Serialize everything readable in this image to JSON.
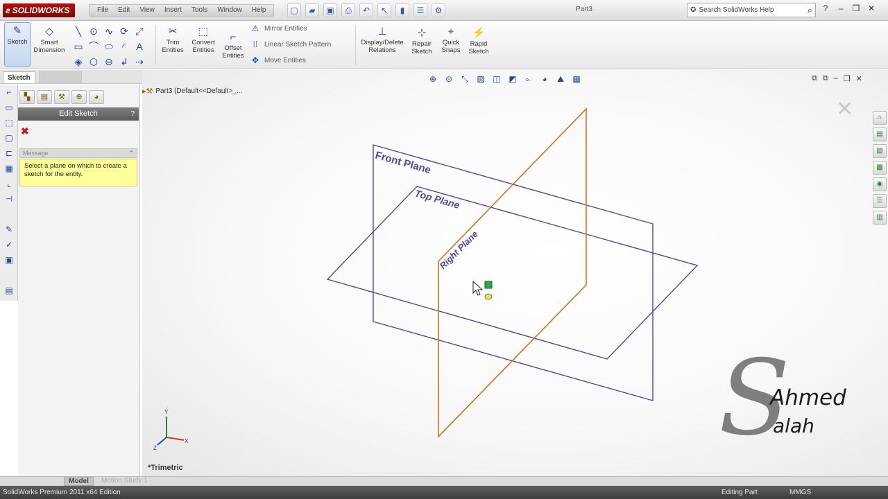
{
  "titlebar": {
    "brand": "SOLIDWORKS",
    "menus": [
      "File",
      "Edit",
      "View",
      "Insert",
      "Tools",
      "Window",
      "Help"
    ],
    "doc_title": "Part3",
    "search_placeholder": "Search SolidWorks Help"
  },
  "command_manager": {
    "sketch": "Sketch",
    "smart_dimension": "Smart\nDimension",
    "trim_entities": "Trim\nEntities",
    "convert_entities": "Convert\nEntities",
    "offset_entities": "Offset\nEntities",
    "mirror_entities": "Mirror Entities",
    "linear_sketch_pattern": "Linear Sketch Pattern",
    "move_entities": "Move Entities",
    "display_delete_relations": "Display/Delete\nRelations",
    "repair_sketch": "Repair\nSketch",
    "quick_snaps": "Quick\nSnaps",
    "rapid_sketch": "Rapid\nSketch"
  },
  "tabs": {
    "sketch": "Sketch"
  },
  "property_manager": {
    "title": "Edit Sketch",
    "help_num": "?",
    "message_heading": "Message",
    "message": "Select a plane on which to create a sketch for the entity."
  },
  "graphics": {
    "tree_item": "Part3  (Default<<Default>_...",
    "view_orientation": "*Trimetric",
    "planes": {
      "front": "Front Plane",
      "top": "Top Plane",
      "right": "Right Plane"
    },
    "triad": {
      "x": "X",
      "y": "Y",
      "z": "Z"
    }
  },
  "watermark": {
    "initial": "S",
    "first": "Ahmed",
    "last": "alah"
  },
  "bottom_tabs": {
    "model": "Model",
    "motion_study": "Motion Study 1"
  },
  "statusbar": {
    "left": "SolidWorks Premium 2011 x64 Edition",
    "mid": "Editing Part",
    "right": "MMGS"
  },
  "colors": {
    "plane_blue": "#4a4a96",
    "plane_orange": "#c8741e",
    "message_yellow": "#ffff99",
    "brand_red": "#9e0a0a"
  }
}
